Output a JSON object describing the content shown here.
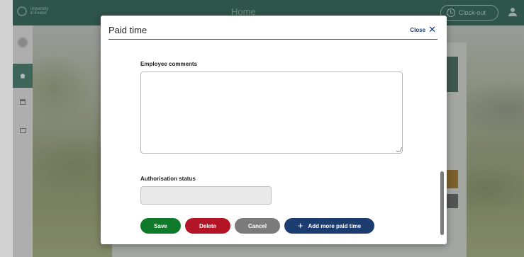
{
  "header": {
    "logo_text": "University of Exeter",
    "title": "Home",
    "clock_out_label": "Clock-out",
    "clock_icon": "clock-icon",
    "user_icon": "user-icon"
  },
  "sidebar": {
    "items": [
      {
        "name": "avatar",
        "icon": "avatar-icon"
      },
      {
        "name": "home",
        "icon": "home-icon"
      },
      {
        "name": "calendar",
        "icon": "calendar-icon"
      },
      {
        "name": "card",
        "icon": "card-icon"
      }
    ]
  },
  "modal": {
    "title": "Paid time",
    "close_label": "Close",
    "close_icon": "close-icon",
    "comments": {
      "label": "Employee comments",
      "value": ""
    },
    "authorisation": {
      "label": "Authorisation status",
      "value": ""
    },
    "buttons": {
      "save": "Save",
      "delete": "Delete",
      "cancel": "Cancel",
      "add_more": "Add more paid time"
    }
  },
  "colors": {
    "brand_green": "#2c5a4c",
    "save": "#0e7a2a",
    "delete": "#b41526",
    "cancel": "#7b7b7b",
    "primary_blue": "#1d3d70"
  }
}
